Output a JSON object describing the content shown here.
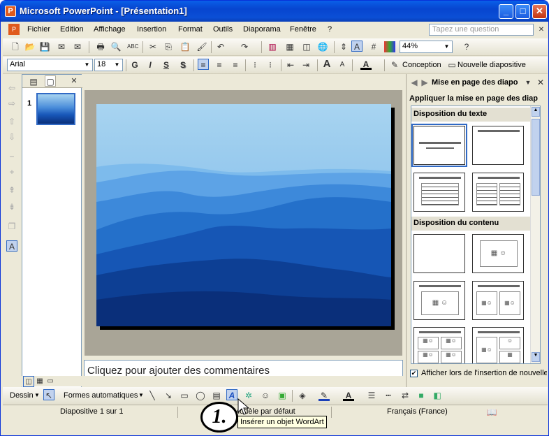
{
  "window": {
    "title": "Microsoft PowerPoint - [Présentation1]",
    "app_icon": "powerpoint-icon",
    "controls": [
      "minimize-icon",
      "maximize-icon",
      "close-icon"
    ]
  },
  "menu": {
    "items": [
      "Fichier",
      "Edition",
      "Affichage",
      "Insertion",
      "Format",
      "Outils",
      "Diaporama",
      "Fenêtre",
      "?"
    ],
    "help_placeholder": "Tapez une question"
  },
  "standard_toolbar": {
    "zoom": "44%"
  },
  "formatting_toolbar": {
    "font": "Arial",
    "size": "18",
    "bold": "G",
    "italic": "I",
    "underline": "S",
    "shadow": "S",
    "design": "Conception",
    "new_slide": "Nouvelle diapositive"
  },
  "thumbnails": {
    "slide_number": "1"
  },
  "notes": {
    "placeholder": "Cliquez pour ajouter des commentaires"
  },
  "task_pane": {
    "title": "Mise en page des diapo",
    "apply_label": "Appliquer la mise en page des diap",
    "section_text": "Disposition du texte",
    "section_content": "Disposition du contenu",
    "checkbox_label": "Afficher lors de l'insertion de nouvelle",
    "checkbox_checked": true
  },
  "drawing_toolbar": {
    "draw": "Dessin",
    "autoshapes": "Formes automatiques"
  },
  "status": {
    "slide": "Diapositive 1 sur 1",
    "design": "Modèle par défaut",
    "language": "Français (France)"
  },
  "tooltip": "Insérer un objet WordArt",
  "callout": "1.",
  "colors": {
    "titlebar": "#0A5FE8",
    "slide_sky": "#A8D4F0",
    "slide_dark": "#0A2F7A"
  }
}
